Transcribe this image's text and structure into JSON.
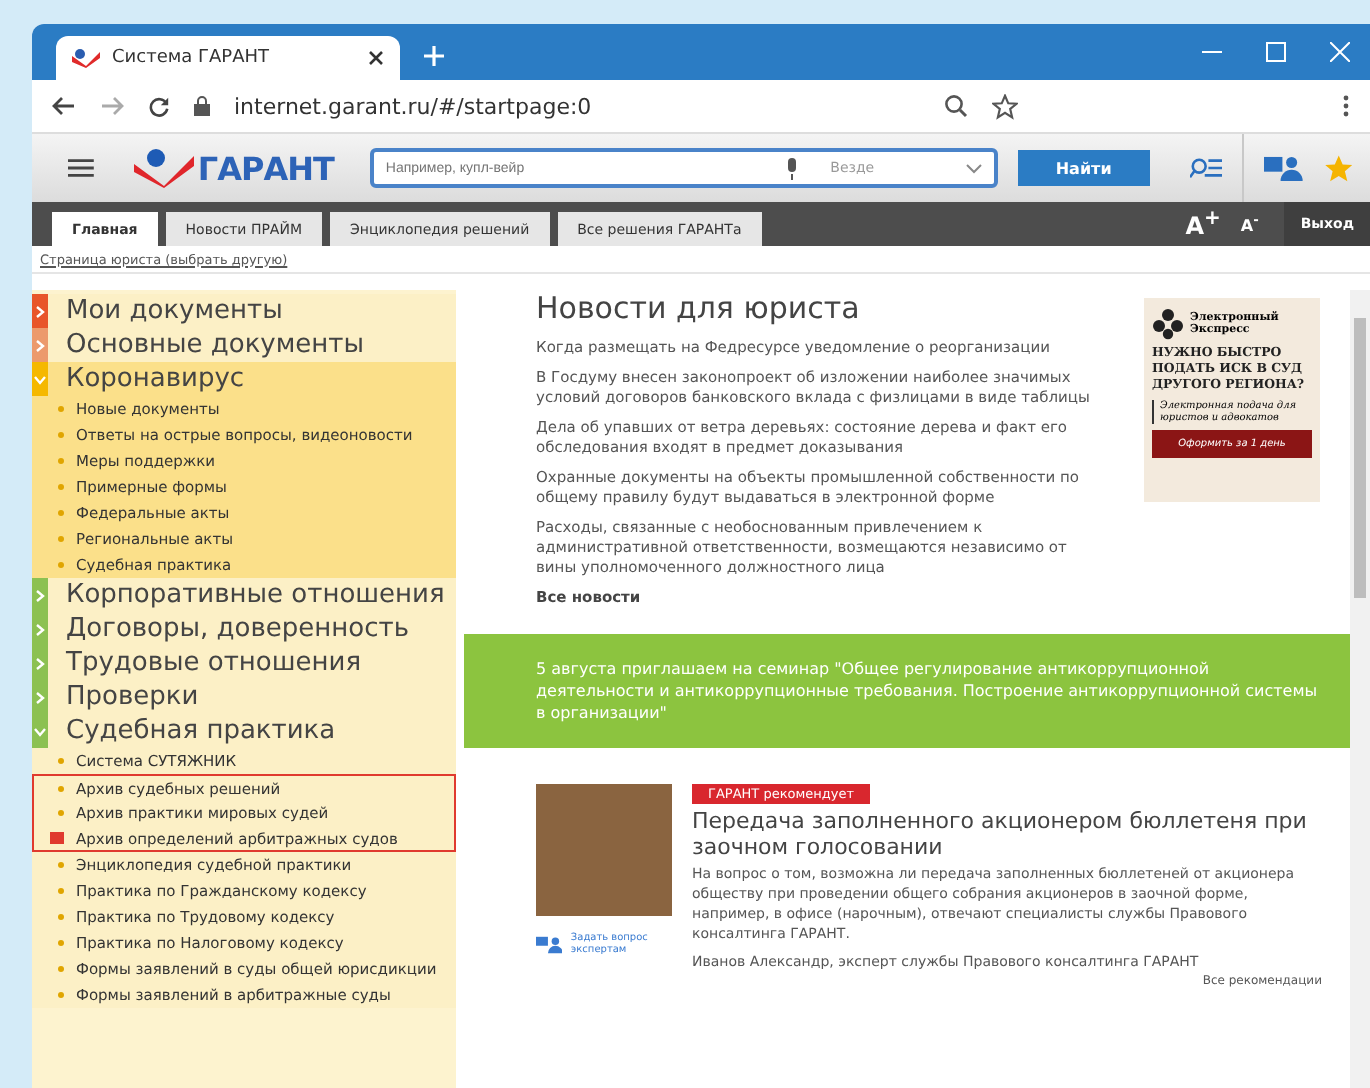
{
  "browser": {
    "tab_title": "Система ГАРАНТ",
    "address": "internet.garant.ru/#/startpage:0"
  },
  "toolbar": {
    "logo": "ГАРАНТ",
    "search_placeholder": "Например, купл-вейр",
    "scope": "Везде",
    "search_button": "Найти"
  },
  "tabs": [
    {
      "label": "Главная",
      "selected": true
    },
    {
      "label": "Новости ПРАЙМ",
      "selected": false
    },
    {
      "label": "Энциклопедия решений",
      "selected": false
    },
    {
      "label": "Все решения ГАРАНТа",
      "selected": false
    }
  ],
  "font_controls": [
    "A$^{+}$",
    "A$^{-}$"
  ],
  "exit": "Выход",
  "breadcrumb": "Страница юриста (выбрать другую)",
  "sidebar": [
    {
      "title": "Мои документы",
      "color": "#e8552a",
      "expanded": false,
      "accent": false
    },
    {
      "title": "Основные документы",
      "color": "#ec9a6c",
      "expanded": false,
      "accent": false
    },
    {
      "title": "Коронавирус",
      "color": "#f5b800",
      "expanded": true,
      "accent": true,
      "children": [
        {
          "label": "Новые документы",
          "highlighted": false,
          "new": false
        },
        {
          "label": "Ответы на острые вопросы, видеоновости",
          "highlighted": false,
          "new": false
        },
        {
          "label": "Меры поддержки",
          "highlighted": false,
          "new": false
        },
        {
          "label": "Примерные формы",
          "highlighted": false,
          "new": false
        },
        {
          "label": "Федеральные акты",
          "highlighted": false,
          "new": false
        },
        {
          "label": "Региональные акты",
          "highlighted": false,
          "new": false
        },
        {
          "label": "Судебная практика",
          "highlighted": false,
          "new": false
        }
      ]
    },
    {
      "title": "Корпоративные отношения",
      "color": "#8cc152",
      "expanded": false,
      "accent": false
    },
    {
      "title": "Договоры, доверенность",
      "color": "#8cc152",
      "expanded": false,
      "accent": false
    },
    {
      "title": "Трудовые отношения",
      "color": "#8cc152",
      "expanded": false,
      "accent": false
    },
    {
      "title": "Проверки",
      "color": "#8cc152",
      "expanded": false,
      "accent": false
    },
    {
      "title": "Судебная практика",
      "color": "#8cc152",
      "expanded": true,
      "accent": false,
      "children": [
        {
          "label": "Система СУТЯЖНИК",
          "highlighted": false,
          "new": false
        },
        {
          "label": "Архив судебных решений",
          "highlighted": true,
          "new": false
        },
        {
          "label": "Архив практики мировых судей",
          "highlighted": true,
          "new": false
        },
        {
          "label": "Архив определений арбитражных судов",
          "highlighted": true,
          "new": true
        },
        {
          "label": "Энциклопедия судебной практики",
          "highlighted": false,
          "new": false
        },
        {
          "label": "Практика по Гражданскому кодексу",
          "highlighted": false,
          "new": false
        },
        {
          "label": "Практика по Трудовому кодексу",
          "highlighted": false,
          "new": false
        },
        {
          "label": "Практика по Налоговому кодексу",
          "highlighted": false,
          "new": false
        },
        {
          "label": "Формы заявлений в суды общей юрисдикции",
          "highlighted": false,
          "new": false
        },
        {
          "label": "Формы заявлений в арбитражные суды",
          "highlighted": false,
          "new": false
        }
      ]
    }
  ],
  "news": {
    "title": "Новости для юриста",
    "items": [
      "Когда размещать на Федресурсе уведомление о реорганизации",
      "В Госдуму внесен законопроект об изложении наиболее значимых условий договоров банковского вклада с физлицами в виде таблицы",
      "Дела об упавших от ветра деревьях: состояние дерева и факт его обследования входят в предмет доказывания",
      "Охранные документы на объекты промышленной собственности по общему правилу будут выдаваться в электронной форме",
      "Расходы, связанные с необоснованным привлечением к административной ответственности, возмещаются независимо от вины уполномоченного должностного лица"
    ],
    "all_link": "Все новости"
  },
  "ad": {
    "brand": "Электронный Экспресс",
    "headline": "НУЖНО БЫСТРО ПОДАТЬ ИСК В СУД ДРУГОГО РЕГИОНА?",
    "subline": "Электронная подача для юристов и адвокатов",
    "button": "Оформить за 1 день"
  },
  "banner": "5 августа приглашаем на семинар \"Общее регулирование антикоррупционной деятельности и антикоррупционные требования. Построение антикоррупционной системы в организации\"",
  "recommend": {
    "badge": "ГАРАНТ рекомендует",
    "title": "Передача заполненного акционером бюллетеня при заочном голосовании",
    "text": "На вопрос о том, возможна ли передача заполненных бюллетеней от акционера обществу при проведении общего собрания акционеров в заочной форме, например, в офисе (нарочным), отвечают специалисты службы Правового консалтинга ГАРАНТ.",
    "author": "Иванов Александр, эксперт службы Правового консалтинга ГАРАНТ",
    "ask": "Задать вопрос экспертам",
    "more": "Все рекомендации"
  }
}
